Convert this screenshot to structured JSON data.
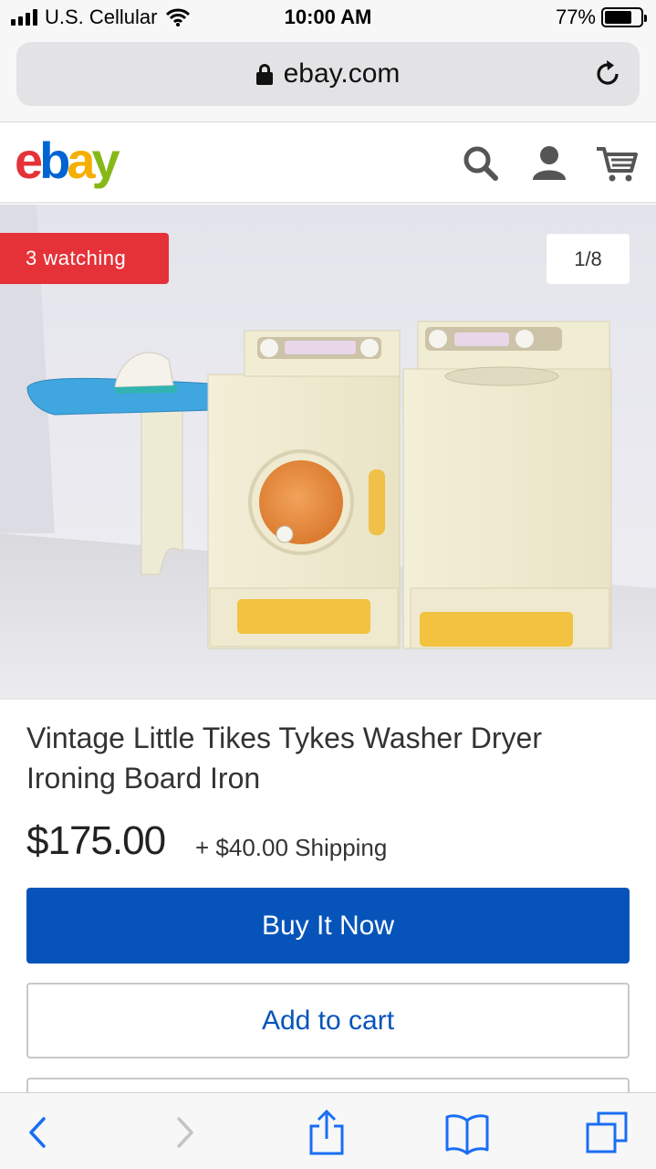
{
  "status_bar": {
    "carrier": "U.S. Cellular",
    "time": "10:00 AM",
    "battery": "77%",
    "battery_level": 0.77
  },
  "browser": {
    "url": "ebay.com",
    "icons": [
      "lock-icon",
      "reload-icon"
    ]
  },
  "header": {
    "logo": {
      "e": "e",
      "b": "b",
      "a": "a",
      "y": "y"
    },
    "brand_colors": {
      "red": "#e53238",
      "blue": "#0064d2",
      "yellow": "#f5af02",
      "green": "#86b817"
    },
    "icons": [
      "search-icon",
      "account-icon",
      "cart-icon"
    ]
  },
  "listing": {
    "watching_badge": "3 watching",
    "image_counter": "1/8",
    "title": "Vintage Little Tikes Tykes Washer Dryer Ironing Board Iron",
    "price": "$175.00",
    "shipping": "+ $40.00 Shipping",
    "buy_now_label": "Buy It Now",
    "add_to_cart_label": "Add to cart",
    "accent_color": "#0654ba"
  },
  "toolbar": {
    "icons": [
      "back-icon",
      "forward-icon",
      "share-icon",
      "bookmarks-icon",
      "tabs-icon"
    ]
  }
}
